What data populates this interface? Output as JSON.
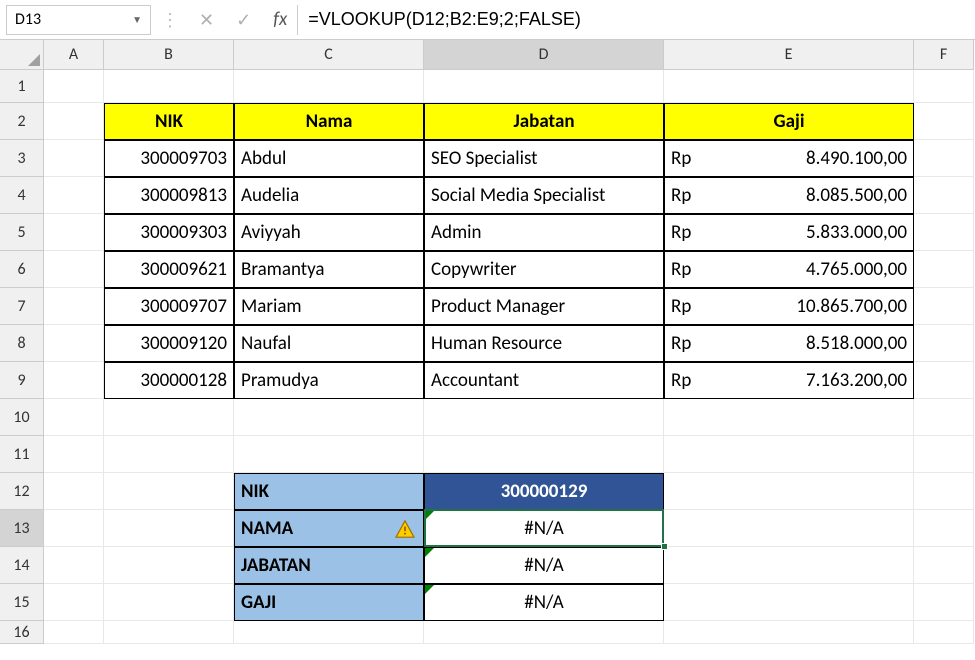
{
  "name_box": "D13",
  "formula": "=VLOOKUP(D12;B2:E9;2;FALSE)",
  "columns": [
    "A",
    "B",
    "C",
    "D",
    "E",
    "F"
  ],
  "rows": [
    "1",
    "2",
    "3",
    "4",
    "5",
    "6",
    "7",
    "8",
    "9",
    "10",
    "11",
    "12",
    "13",
    "14",
    "15",
    "16"
  ],
  "table": {
    "headers": {
      "nik": "NIK",
      "nama": "Nama",
      "jabatan": "Jabatan",
      "gaji": "Gaji"
    },
    "rows": [
      {
        "nik": "300009703",
        "nama": "Abdul",
        "jabatan": "SEO Specialist",
        "gaji_prefix": "Rp",
        "gaji": "8.490.100,00"
      },
      {
        "nik": "300009813",
        "nama": "Audelia",
        "jabatan": "Social Media Specialist",
        "gaji_prefix": "Rp",
        "gaji": "8.085.500,00"
      },
      {
        "nik": "300009303",
        "nama": "Aviyyah",
        "jabatan": "Admin",
        "gaji_prefix": "Rp",
        "gaji": "5.833.000,00"
      },
      {
        "nik": "300009621",
        "nama": "Bramantya",
        "jabatan": "Copywriter",
        "gaji_prefix": "Rp",
        "gaji": "4.765.000,00"
      },
      {
        "nik": "300009707",
        "nama": "Mariam",
        "jabatan": "Product Manager",
        "gaji_prefix": "Rp",
        "gaji": "10.865.700,00"
      },
      {
        "nik": "300009120",
        "nama": "Naufal",
        "jabatan": "Human Resource",
        "gaji_prefix": "Rp",
        "gaji": "8.518.000,00"
      },
      {
        "nik": "300000128",
        "nama": "Pramudya",
        "jabatan": "Accountant",
        "gaji_prefix": "Rp",
        "gaji": "7.163.200,00"
      }
    ]
  },
  "lookup": {
    "labels": {
      "nik": "NIK",
      "nama": "NAMA",
      "jabatan": "JABATAN",
      "gaji": "GAJI"
    },
    "values": {
      "nik": "300000129",
      "nama": "#N/A",
      "jabatan": "#N/A",
      "gaji": "#N/A"
    }
  },
  "active_cell": {
    "row": 13,
    "col": "D"
  },
  "chart_data": {
    "type": "table",
    "title": "Employee Data",
    "columns": [
      "NIK",
      "Nama",
      "Jabatan",
      "Gaji"
    ],
    "rows": [
      [
        "300009703",
        "Abdul",
        "SEO Specialist",
        "Rp 8.490.100,00"
      ],
      [
        "300009813",
        "Audelia",
        "Social Media Specialist",
        "Rp 8.085.500,00"
      ],
      [
        "300009303",
        "Aviyyah",
        "Admin",
        "Rp 5.833.000,00"
      ],
      [
        "300009621",
        "Bramantya",
        "Copywriter",
        "Rp 4.765.000,00"
      ],
      [
        "300009707",
        "Mariam",
        "Product Manager",
        "Rp 10.865.700,00"
      ],
      [
        "300009120",
        "Naufal",
        "Human Resource",
        "Rp 8.518.000,00"
      ],
      [
        "300000128",
        "Pramudya",
        "Accountant",
        "Rp 7.163.200,00"
      ]
    ]
  }
}
